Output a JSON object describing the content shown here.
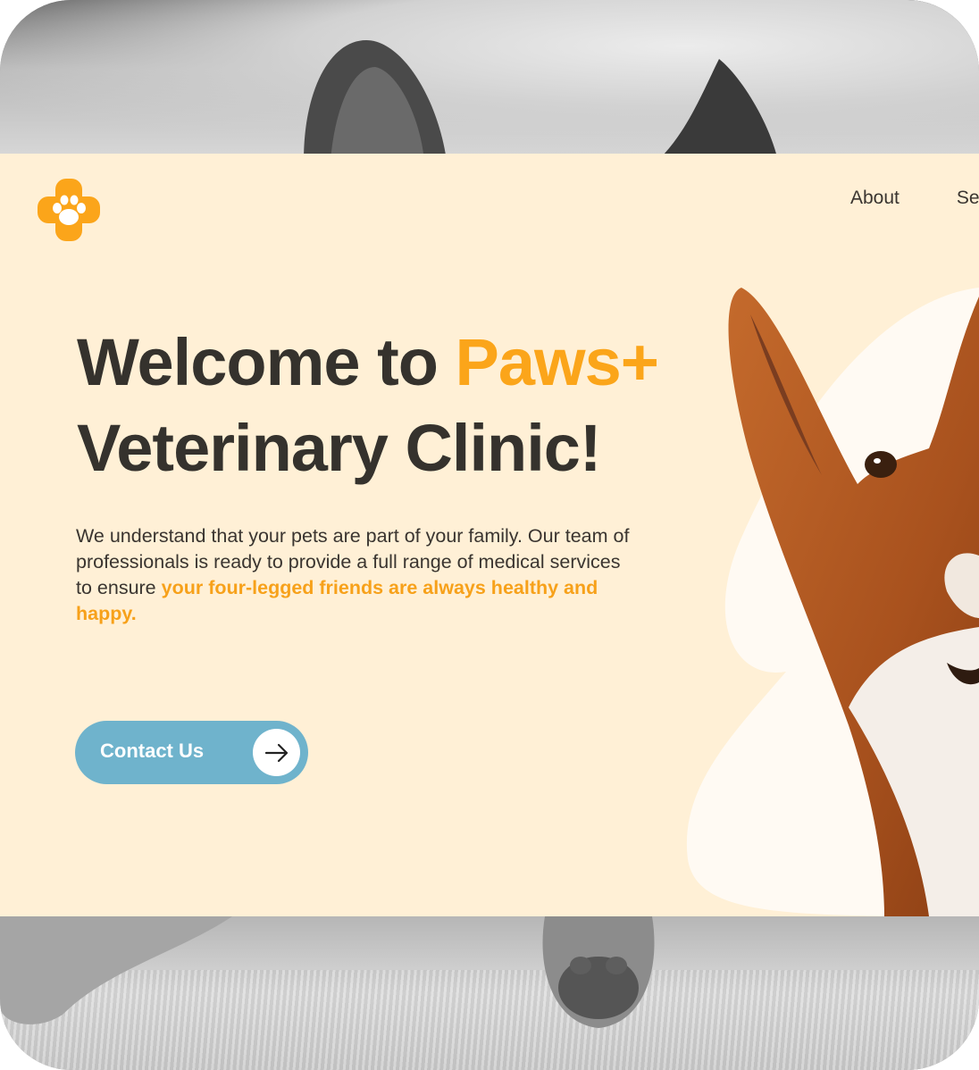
{
  "brand": {
    "logo_icon": "paw-cross-icon",
    "accent_color": "#fba51a"
  },
  "nav": {
    "items": [
      {
        "label": "About"
      },
      {
        "label": "Se"
      }
    ]
  },
  "hero": {
    "title_part1": "Welcome to ",
    "title_accent": "Paws+",
    "title_line2": "Veterinary Clinic!",
    "body_text": "We understand that your pets are part of your family. Our team of professionals is ready to provide a full range of medical services to ensure ",
    "body_accent": "your four-legged friends are always healthy and happy.",
    "cta_label": "Contact Us",
    "cta_icon": "arrow-right-icon",
    "background_color": "#fff0d6",
    "cta_color": "#6fb3cc"
  }
}
